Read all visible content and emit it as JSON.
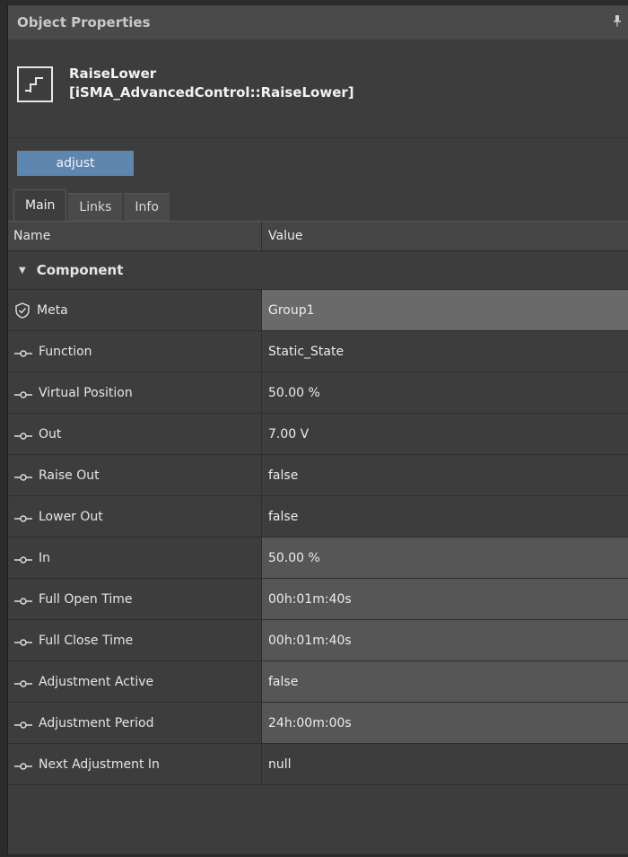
{
  "panel": {
    "title": "Object Properties",
    "pin_glyph": "†"
  },
  "component": {
    "name": "RaiseLower",
    "type": "[iSMA_AdvancedControl::RaiseLower]",
    "icon": "raise-lower-icon"
  },
  "actions": {
    "adjust_label": "adjust"
  },
  "tabs": [
    {
      "label": "Main"
    },
    {
      "label": "Links"
    },
    {
      "label": "Info"
    }
  ],
  "grid": {
    "columns": {
      "name": "Name",
      "value": "Value"
    },
    "group_label": "Component",
    "rows": [
      {
        "name": "Meta",
        "value": "Group1",
        "icon": "shield-check-icon"
      },
      {
        "name": "Function",
        "value": "Static_State",
        "icon": "slot-icon"
      },
      {
        "name": "Virtual Position",
        "value": "50.00 %",
        "icon": "slot-icon"
      },
      {
        "name": "Out",
        "value": "7.00 V",
        "icon": "slot-icon"
      },
      {
        "name": "Raise Out",
        "value": "false",
        "icon": "slot-icon"
      },
      {
        "name": "Lower Out",
        "value": "false",
        "icon": "slot-icon"
      },
      {
        "name": "In",
        "value": "50.00 %",
        "icon": "slot-icon"
      },
      {
        "name": "Full Open Time",
        "value": "00h:01m:40s",
        "icon": "slot-icon"
      },
      {
        "name": "Full Close Time",
        "value": "00h:01m:40s",
        "icon": "slot-icon"
      },
      {
        "name": "Adjustment Active",
        "value": "false",
        "icon": "slot-icon"
      },
      {
        "name": "Adjustment Period",
        "value": "24h:00m:00s",
        "icon": "slot-icon"
      },
      {
        "name": "Next Adjustment In",
        "value": "null",
        "icon": "slot-icon"
      }
    ]
  },
  "colors": {
    "accent_button": "#5f86ae",
    "panel_bg": "#3d3d3d",
    "editable_cell": "#6a6a6a"
  }
}
